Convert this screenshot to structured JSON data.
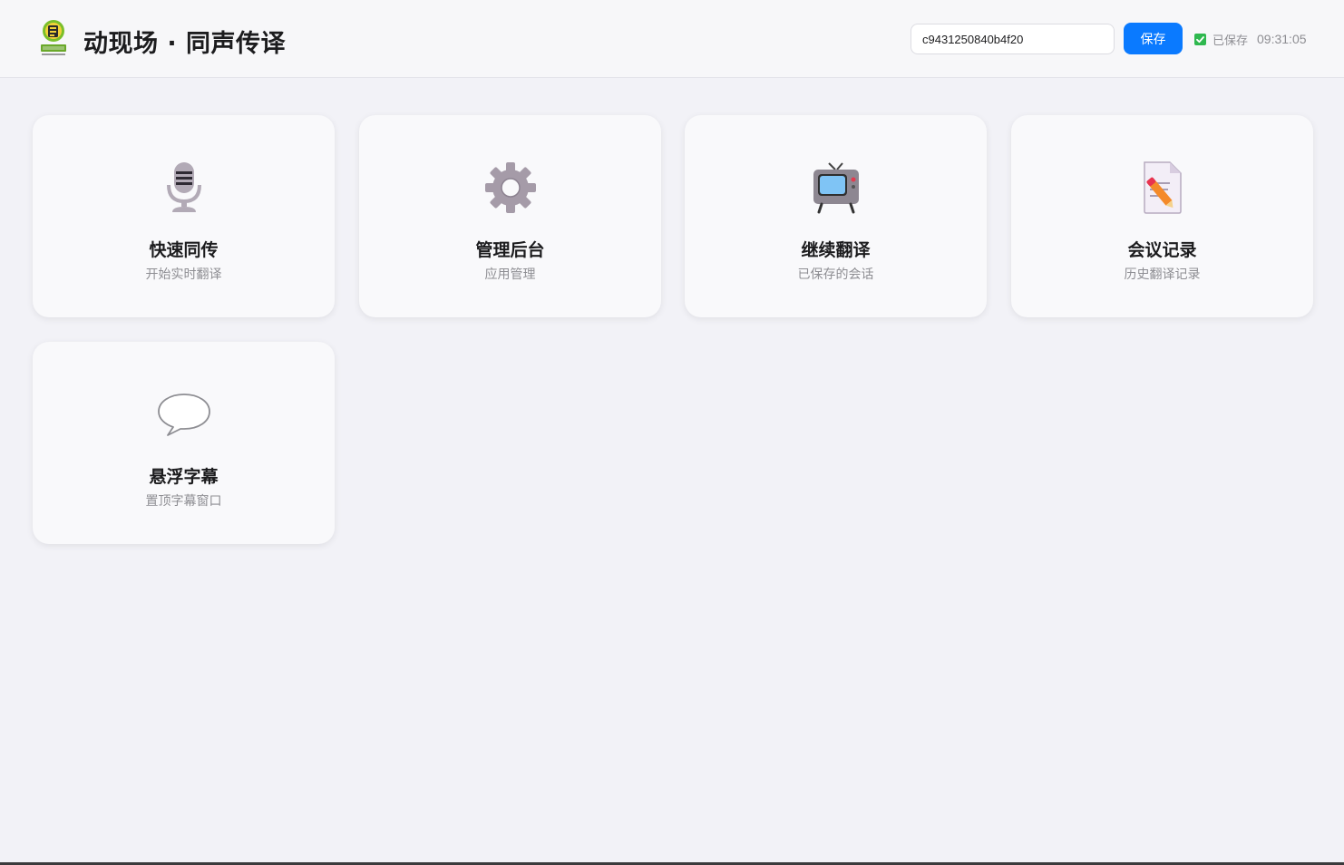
{
  "header": {
    "logo_alt": "动现场",
    "title": "动现场 · 同声传译",
    "session_id_value": "c9431250840b4f20",
    "save_label": "保存",
    "saved_label": "已保存",
    "time": "09:31:05"
  },
  "cards": [
    {
      "icon": "microphone-icon",
      "title": "快速同传",
      "subtitle": "开始实时翻译"
    },
    {
      "icon": "gear-icon",
      "title": "管理后台",
      "subtitle": "应用管理"
    },
    {
      "icon": "television-icon",
      "title": "继续翻译",
      "subtitle": "已保存的会话"
    },
    {
      "icon": "memo-icon",
      "title": "会议记录",
      "subtitle": "历史翻译记录"
    },
    {
      "icon": "speech-bubble-icon",
      "title": "悬浮字幕",
      "subtitle": "置顶字幕窗口"
    }
  ],
  "colors": {
    "accent": "#0a7aff",
    "saved_check": "#2fb84f",
    "background": "#f2f2f7",
    "card": "#f9f9fb"
  }
}
